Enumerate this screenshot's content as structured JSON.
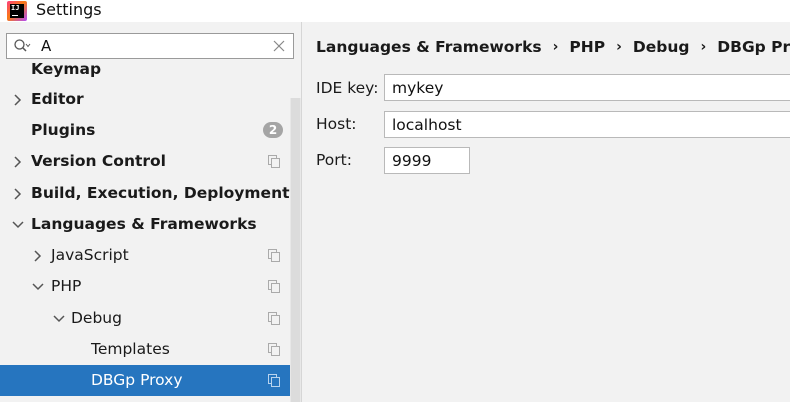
{
  "window": {
    "title": "Settings",
    "app_icon": "intellij-icon"
  },
  "search": {
    "value": "A",
    "icon": "search-icon",
    "clear_icon": "close-icon"
  },
  "sidebar": {
    "items": [
      {
        "label": "Keymap"
      },
      {
        "label": "Editor"
      },
      {
        "label": "Plugins",
        "badge": "2"
      },
      {
        "label": "Version Control"
      },
      {
        "label": "Build, Execution, Deployment"
      },
      {
        "label": "Languages & Frameworks"
      },
      {
        "label": "JavaScript"
      },
      {
        "label": "PHP"
      },
      {
        "label": "Debug"
      },
      {
        "label": "Templates"
      },
      {
        "label": "DBGp Proxy"
      }
    ],
    "selected_color": "#2675bf"
  },
  "breadcrumb": [
    "Languages & Frameworks",
    "PHP",
    "Debug",
    "DBGp Proxy"
  ],
  "form": {
    "ide_key": {
      "label": "IDE key:",
      "value": "mykey"
    },
    "host": {
      "label": "Host:",
      "value": "localhost"
    },
    "port": {
      "label": "Port:",
      "value": "9999"
    }
  }
}
